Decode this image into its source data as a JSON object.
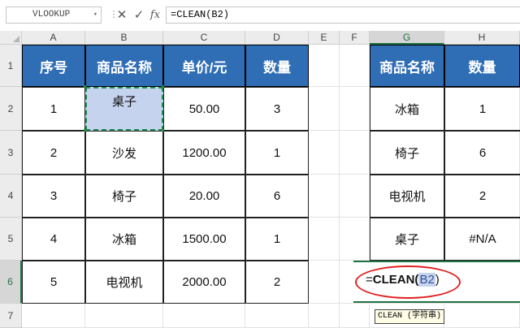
{
  "formula_bar": {
    "name_box": "VLOOKUP",
    "cancel_glyph": "✕",
    "enter_glyph": "✓",
    "fx_label": "fx",
    "formula": "=CLEAN(B2)"
  },
  "columns": [
    "A",
    "B",
    "C",
    "D",
    "E",
    "F",
    "G",
    "H"
  ],
  "rows": [
    "1",
    "2",
    "3",
    "4",
    "5",
    "6",
    "7"
  ],
  "table_left": {
    "headers": [
      "序号",
      "商品名称",
      "单价/元",
      "数量"
    ],
    "rows": [
      [
        "1",
        "桌子",
        "50.00",
        "3"
      ],
      [
        "2",
        "沙发",
        "1200.00",
        "1"
      ],
      [
        "3",
        "椅子",
        "20.00",
        "6"
      ],
      [
        "4",
        "冰箱",
        "1500.00",
        "1"
      ],
      [
        "5",
        "电视机",
        "2000.00",
        "2"
      ]
    ]
  },
  "table_right": {
    "headers": [
      "商品名称",
      "数量"
    ],
    "rows": [
      [
        "冰箱",
        "1"
      ],
      [
        "椅子",
        "6"
      ],
      [
        "电视机",
        "2"
      ],
      [
        "桌子",
        "#N/A"
      ]
    ]
  },
  "editing": {
    "prefix": "=",
    "func": "CLEAN(",
    "ref": "B2",
    "suffix": ")",
    "tooltip": "CLEAN (字符串)"
  },
  "colors": {
    "header_fill": "#2f6db5",
    "selection_fill": "#c6d3ef",
    "annotation_ellipse": "#e02020",
    "excel_green": "#217346"
  }
}
